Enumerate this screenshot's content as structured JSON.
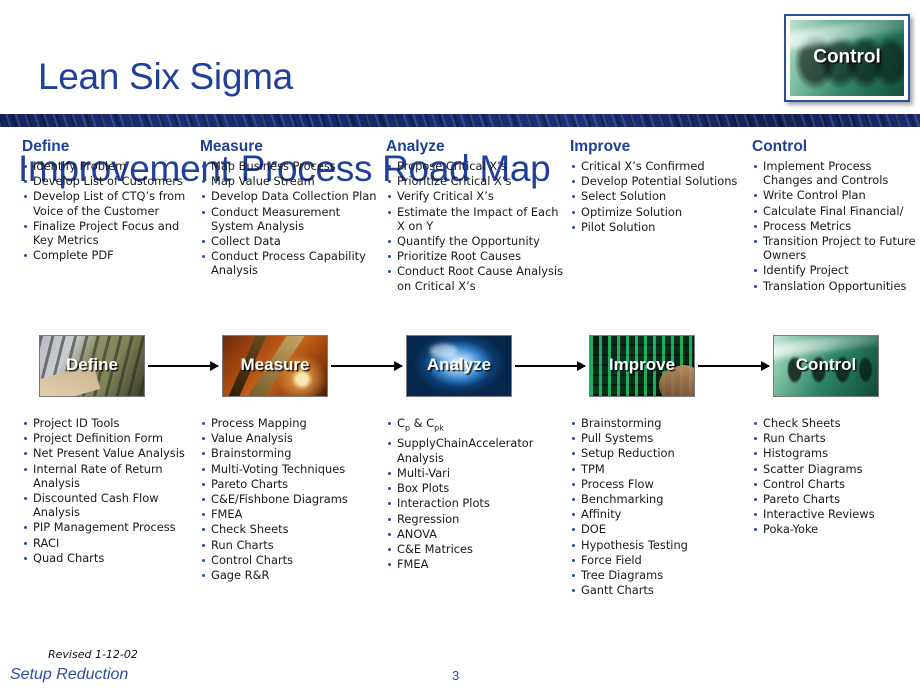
{
  "header": {
    "title_line_1": "Lean Six Sigma",
    "title_line_2": "Improvement Process Road Map",
    "badge_label": "Control"
  },
  "columns": [
    {
      "id": "define",
      "heading": "Define",
      "stage_label": "Define",
      "top_items": [
        "Identify Problem",
        "Develop List of Customers",
        "Develop List of CTQ’s from Voice of the Customer",
        "Finalize Project Focus and Key Metrics",
        "Complete PDF"
      ],
      "bottom_items": [
        "Project ID Tools",
        "Project Definition Form",
        "Net Present Value Analysis",
        "Internal Rate of Return Analysis",
        "Discounted Cash Flow Analysis",
        "PIP Management Process",
        "RACI",
        "Quad Charts"
      ]
    },
    {
      "id": "measure",
      "heading": "Measure",
      "stage_label": "Measure",
      "top_items": [
        "Map Business Process",
        "Map Value Stream",
        "Develop Data Collection Plan",
        "Conduct Measurement System Analysis",
        "Collect Data",
        "Conduct Process Capability Analysis"
      ],
      "bottom_items": [
        "Process Mapping",
        "Value Analysis",
        "Brainstorming",
        "Multi-Voting Techniques",
        "Pareto Charts",
        "C&E/Fishbone Diagrams",
        "FMEA",
        "Check Sheets",
        "Run Charts",
        "Control Charts",
        "Gage R&R"
      ]
    },
    {
      "id": "analyze",
      "heading": "Analyze",
      "stage_label": "Analyze",
      "top_items": [
        "Propose Critical X’s",
        "Prioritize Critical X’s",
        "Verify Critical X’s",
        "Estimate the Impact of Each X on Y",
        "Quantify the Opportunity",
        "Prioritize Root Causes",
        "Conduct Root Cause Analysis on Critical X’s"
      ],
      "bottom_items": [
        "Cp & Cpk",
        "SupplyChainAccelerator Analysis",
        "Multi-Vari",
        "Box Plots",
        "Interaction Plots",
        "Regression",
        "ANOVA",
        "C&E Matrices",
        "FMEA"
      ],
      "bottom_items_html": [
        "C<sub>p</sub> &amp; C<sub>pk</sub>"
      ]
    },
    {
      "id": "improve",
      "heading": "Improve",
      "stage_label": "Improve",
      "top_items": [
        "Critical X’s Confirmed",
        "Develop Potential Solutions",
        "Select Solution",
        "Optimize Solution",
        "Pilot Solution"
      ],
      "bottom_items": [
        "Brainstorming",
        "Pull Systems",
        "Setup Reduction",
        "TPM",
        "Process Flow",
        "Benchmarking",
        "Affinity",
        "DOE",
        "Hypothesis Testing",
        "Force Field",
        "Tree Diagrams",
        "Gantt Charts"
      ]
    },
    {
      "id": "control",
      "heading": "Control",
      "stage_label": "Control",
      "top_items": [
        "Implement Process Changes and Controls",
        "Write Control Plan",
        "Calculate Final Financial/",
        "Process Metrics",
        "Transition Project to Future Owners",
        "Identify Project",
        "Translation Opportunities"
      ],
      "bottom_items": [
        "Check Sheets",
        "Run Charts",
        "Histograms",
        "Scatter Diagrams",
        "Control Charts",
        "Pareto Charts",
        "Interactive Reviews",
        "Poka-Yoke"
      ]
    }
  ],
  "footer": {
    "revised": "Revised 1-12-02",
    "title": "Setup Reduction",
    "page_number": "3"
  },
  "colors": {
    "title_blue": "#20409A",
    "heading_blue": "#1F4099",
    "bullet_blue": "#2B4EA2",
    "rule_navy": "#152868",
    "body_text": "#1A1A1A"
  }
}
